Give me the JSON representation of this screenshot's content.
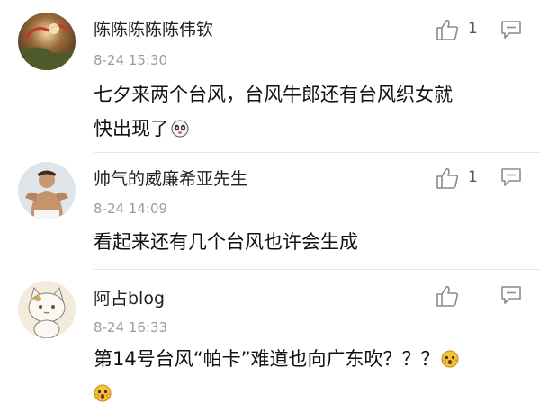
{
  "comments": [
    {
      "username": "陈陈陈陈陈伟钦",
      "time": "8-24 15:30",
      "line1": "七夕来两个台风，台风牛郎还有台风织女就",
      "line2": "快出现了",
      "likes": "1",
      "emoji": "panda-face-icon"
    },
    {
      "username": "帅气的威廉希亚先生",
      "time": "8-24 14:09",
      "line1": "看起来还有几个台风也许会生成",
      "likes": "1"
    },
    {
      "username": "阿占blog",
      "time": "8-24 16:33",
      "line1": "第14号台风“帕卡”难道也向广东吹？？？",
      "likes": "",
      "emoji": "scared-face-icon"
    }
  ]
}
